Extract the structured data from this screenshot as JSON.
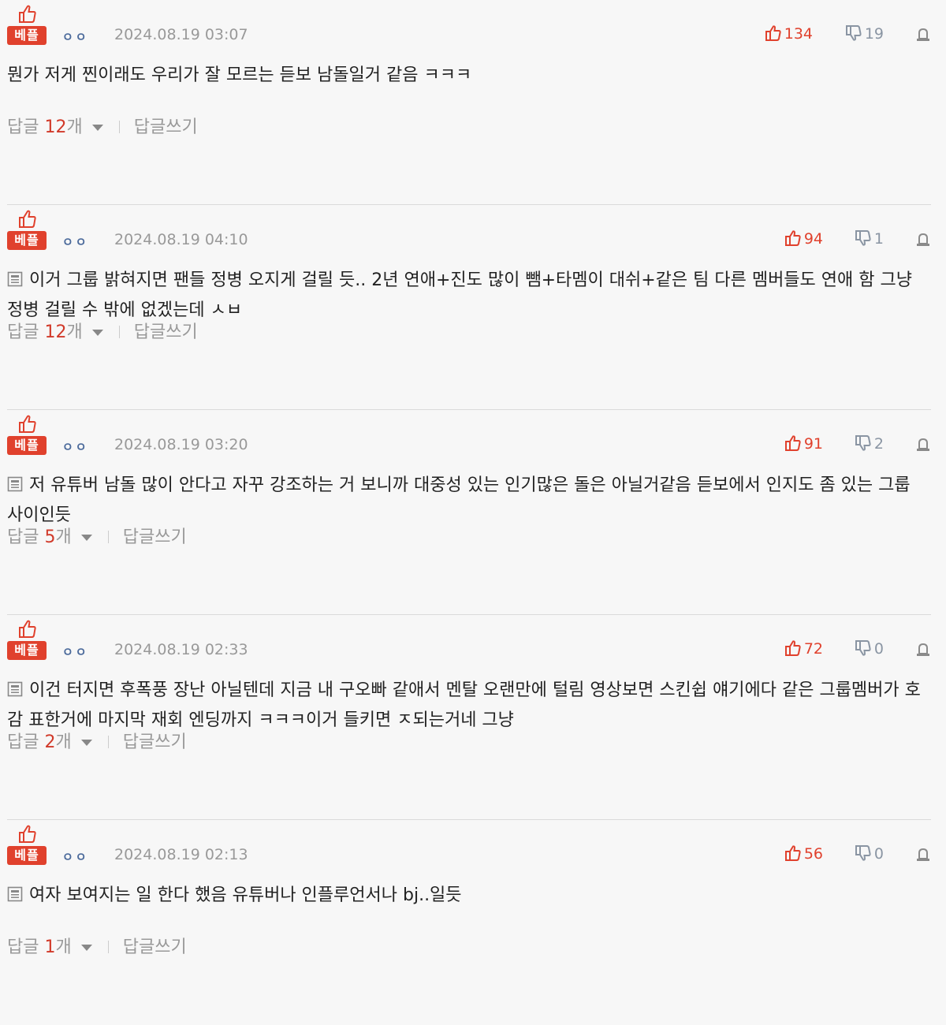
{
  "best_label": "베플",
  "icons": {
    "thumb_up": "thumbs-up-icon",
    "thumb_down": "thumbs-down-icon",
    "report": "report-icon",
    "doc": "document-icon",
    "caret": "caret-down-icon"
  },
  "colors": {
    "accent": "#e0412d",
    "down": "#8a95a3",
    "muted": "#999999"
  },
  "reply_label": "답글",
  "reply_unit": "개",
  "write_label": "답글쓰기",
  "comments": [
    {
      "nick": "ㅇㅇ",
      "date": "2024.08.19 03:07",
      "up": "134",
      "down": "19",
      "has_doc_icon": false,
      "text": "뭔가 저게 찐이래도 우리가 잘 모르는 듣보 남돌일거 같음 ㅋㅋㅋ",
      "replies": "12"
    },
    {
      "nick": "ㅇㅇ",
      "date": "2024.08.19 04:10",
      "up": "94",
      "down": "1",
      "has_doc_icon": true,
      "text": "이거 그룹 밝혀지면 팬들 정병 오지게 걸릴 듯.. 2년 연애+진도 많이 뺌+타멤이 대쉬+같은 팀 다른 멤버들도 연애 함 그냥 정병 걸릴 수 밖에 없겠는데 ㅅㅂ",
      "replies": "12"
    },
    {
      "nick": "ㅇㅇ",
      "date": "2024.08.19 03:20",
      "up": "91",
      "down": "2",
      "has_doc_icon": true,
      "text": "저 유튜버 남돌 많이 안다고 자꾸 강조하는 거 보니까 대중성 있는 인기많은 돌은 아닐거같음 듣보에서 인지도 좀 있는 그룹 사이인듯",
      "replies": "5"
    },
    {
      "nick": "ㅇㅇ",
      "date": "2024.08.19 02:33",
      "up": "72",
      "down": "0",
      "has_doc_icon": true,
      "text": "이건 터지면 후폭풍 장난 아닐텐데 지금 내 구오빠 같애서 멘탈 오랜만에 털림 영상보면 스킨쉽 얘기에다 같은 그룹멤버가 호감 표한거에 마지막 재회 엔딩까지 ㅋㅋㅋ이거 들키면 ㅈ되는거네 그냥",
      "replies": "2"
    },
    {
      "nick": "ㅇㅇ",
      "date": "2024.08.19 02:13",
      "up": "56",
      "down": "0",
      "has_doc_icon": true,
      "text": "여자 보여지는 일 한다 했음 유튜버나 인플루언서나 bj..일듯",
      "replies": "1"
    }
  ]
}
